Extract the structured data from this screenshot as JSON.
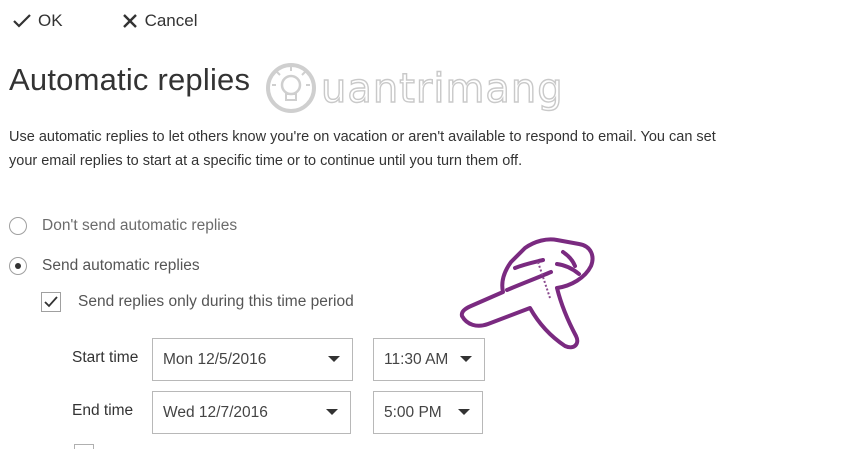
{
  "toolbar": {
    "ok_label": "OK",
    "cancel_label": "Cancel"
  },
  "page": {
    "title": "Automatic replies",
    "description_line1": "Use automatic replies to let others know you're on vacation or aren't available to respond to email. You can set",
    "description_line2": "your email replies to start at a specific time or to continue until you turn them off."
  },
  "watermark": {
    "text": "uantrimang"
  },
  "options": {
    "dont_send_label": "Don't send automatic replies",
    "dont_send_checked": false,
    "send_label": "Send automatic replies",
    "send_checked": true,
    "time_period_label": "Send replies only during this time period",
    "time_period_checked": true
  },
  "schedule": {
    "start_label": "Start time",
    "start_date": "Mon 12/5/2016",
    "start_time": "11:30 AM",
    "end_label": "End time",
    "end_date": "Wed 12/7/2016",
    "end_time": "5:00 PM"
  },
  "colors": {
    "annotation": "#7a2a80",
    "watermark": "#c9c9c9"
  },
  "icons": {
    "ok": "checkmark-icon",
    "cancel": "close-icon",
    "annotation": "pointing-hand-icon",
    "watermark": "lightbulb-icon"
  }
}
